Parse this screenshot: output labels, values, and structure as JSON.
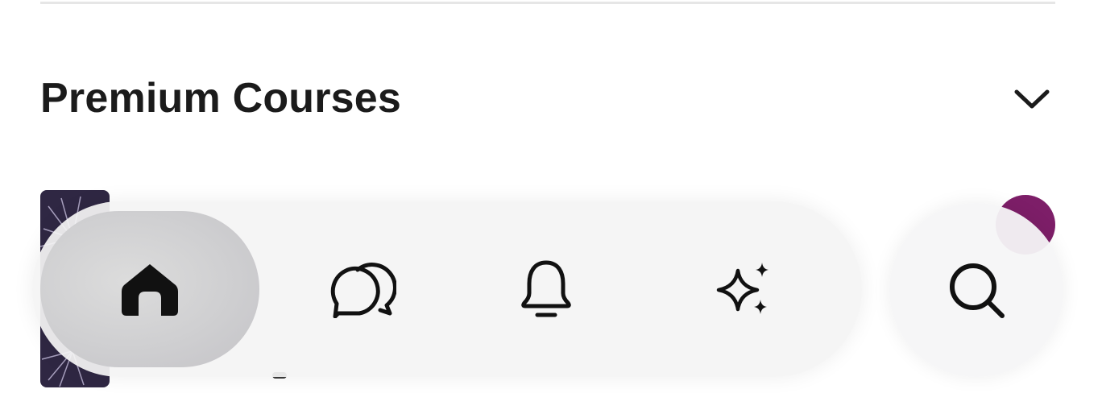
{
  "section": {
    "title": "Premium Courses"
  },
  "icons": {
    "chevron": "chevron-down-icon",
    "home": "home-icon",
    "messages": "chat-bubbles-icon",
    "notifications": "bell-icon",
    "ai": "sparkles-icon",
    "search": "search-icon"
  },
  "colors": {
    "title": "#1b1b1b",
    "thumbnail": "#2f2743",
    "badge": "#7d1e68",
    "tabbar": "#f4f4f4",
    "active_tab": "#cfcfd1",
    "icon": "#111111"
  }
}
